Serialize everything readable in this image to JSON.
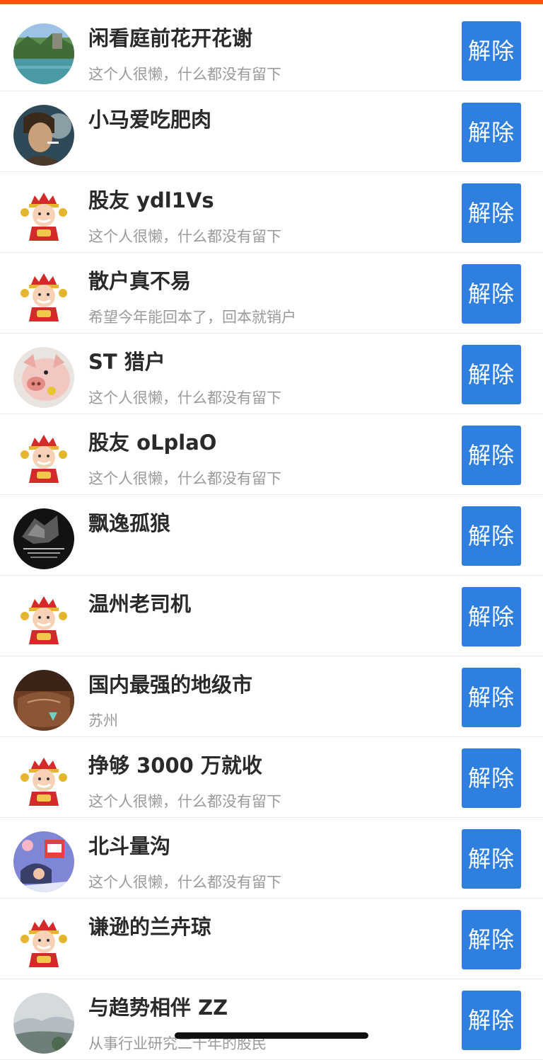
{
  "accent_color": "#f15a0c",
  "button_color": "#2f7fdf",
  "users": [
    {
      "name": "闲看庭前花开花谢",
      "signature": "这个人很懒，什么都没有留下",
      "avatar": "landscape-avatar",
      "button": "解除"
    },
    {
      "name": "小马爱吃肥肉",
      "signature": "",
      "avatar": "smoking-man-avatar",
      "button": "解除"
    },
    {
      "name": "股友 ydl1Vs",
      "signature": "这个人很懒，什么都没有留下",
      "avatar": "fortune-god-avatar",
      "button": "解除"
    },
    {
      "name": "散户真不易",
      "signature": "希望今年能回本了，回本就销户",
      "avatar": "fortune-god-avatar",
      "button": "解除"
    },
    {
      "name": "ST 猎户",
      "signature": "这个人很懒，什么都没有留下",
      "avatar": "pig-avatar",
      "button": "解除"
    },
    {
      "name": "股友 oLplaO",
      "signature": "这个人很懒，什么都没有留下",
      "avatar": "fortune-god-avatar",
      "button": "解除"
    },
    {
      "name": "飘逸孤狼",
      "signature": "",
      "avatar": "wolf-avatar",
      "button": "解除"
    },
    {
      "name": "温州老司机",
      "signature": "",
      "avatar": "fortune-god-avatar",
      "button": "解除"
    },
    {
      "name": "国内最强的地级市",
      "signature": "苏州",
      "avatar": "antique-vase-avatar",
      "button": "解除"
    },
    {
      "name": "挣够 3000 万就收",
      "signature": "这个人很懒，什么都没有留下",
      "avatar": "fortune-god-avatar",
      "button": "解除"
    },
    {
      "name": "北斗量沟",
      "signature": "这个人很懒，什么都没有留下",
      "avatar": "cartoon-avatar",
      "button": "解除"
    },
    {
      "name": "谦逊的兰卉琼",
      "signature": "",
      "avatar": "fortune-god-avatar",
      "button": "解除"
    },
    {
      "name": "与趋势相伴 ZZ",
      "signature": "从事行业研究二十年的股民",
      "avatar": "mountain-mist-avatar",
      "button": "解除"
    }
  ]
}
